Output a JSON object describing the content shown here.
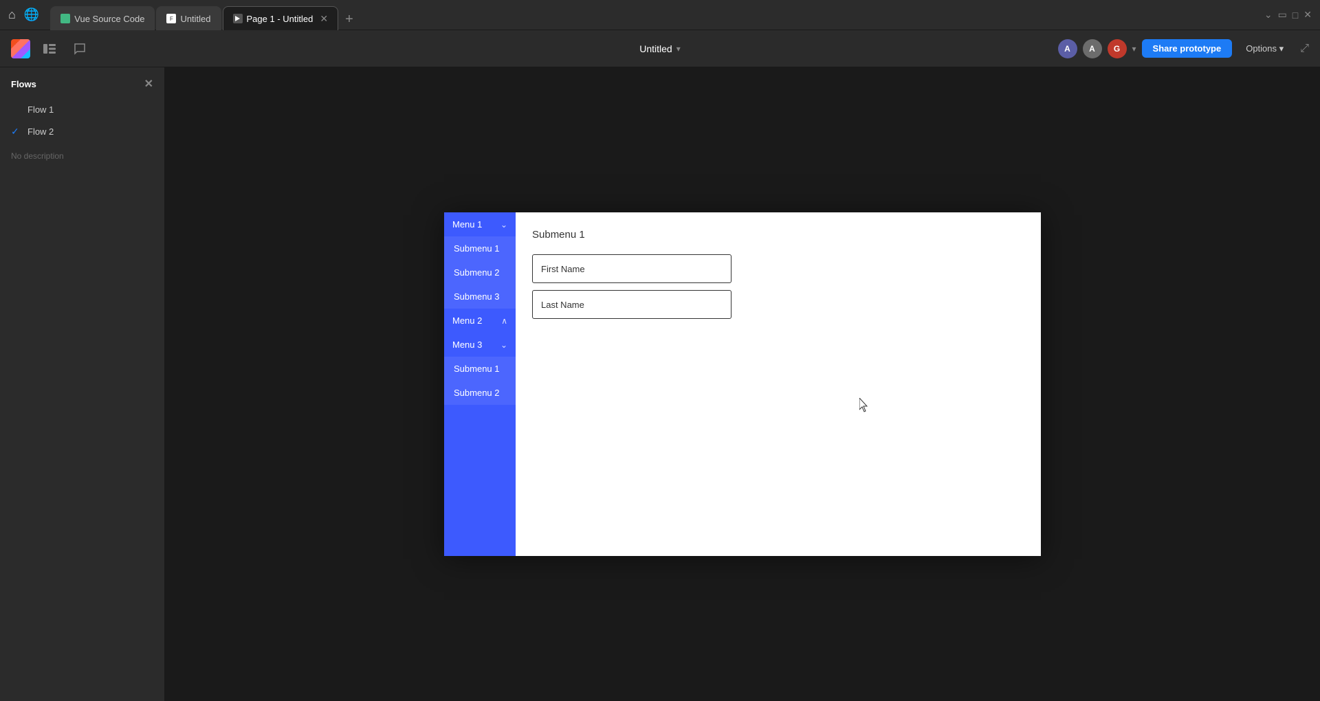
{
  "browser": {
    "tabs": [
      {
        "id": "vue",
        "label": "Vue Source Code",
        "favicon_type": "vue",
        "active": false
      },
      {
        "id": "untitled",
        "label": "Untitled",
        "favicon_type": "fig",
        "active": false
      },
      {
        "id": "page1",
        "label": "Page 1 - Untitled",
        "favicon_type": "play",
        "active": true,
        "closable": true
      }
    ],
    "add_tab_label": "+"
  },
  "header": {
    "project_name": "Untitled",
    "dropdown_symbol": "▾",
    "avatars": [
      {
        "id": "a1",
        "label": "A",
        "class": "avatar-a1"
      },
      {
        "id": "a2",
        "label": "A",
        "class": "avatar-a2"
      },
      {
        "id": "g",
        "label": "G",
        "class": "avatar-g"
      }
    ],
    "share_button_label": "Share prototype",
    "options_label": "Options",
    "options_dropdown": "▾",
    "expand_icon": "⤢"
  },
  "sidebar": {
    "title": "Flows",
    "close_icon": "✕",
    "flows": [
      {
        "id": "flow1",
        "label": "Flow 1",
        "checked": false
      },
      {
        "id": "flow2",
        "label": "Flow 2",
        "checked": true
      }
    ],
    "no_description": "No description"
  },
  "prototype": {
    "menu": [
      {
        "id": "menu1",
        "label": "Menu 1",
        "chevron": "⌄",
        "type": "parent"
      },
      {
        "id": "submenu1a",
        "label": "Submenu 1",
        "type": "submenu"
      },
      {
        "id": "submenu2a",
        "label": "Submenu 2",
        "type": "submenu"
      },
      {
        "id": "submenu3a",
        "label": "Submenu 3",
        "type": "submenu"
      },
      {
        "id": "menu2",
        "label": "Menu 2",
        "chevron": "∧",
        "type": "parent"
      },
      {
        "id": "menu3",
        "label": "Menu 3",
        "chevron": "⌄",
        "type": "parent"
      },
      {
        "id": "submenu1b",
        "label": "Submenu 1",
        "type": "submenu"
      },
      {
        "id": "submenu2b",
        "label": "Submenu 2",
        "type": "submenu"
      }
    ],
    "content": {
      "active_submenu": "Submenu 1",
      "first_name_label": "First Name",
      "last_name_label": "Last Name"
    }
  }
}
